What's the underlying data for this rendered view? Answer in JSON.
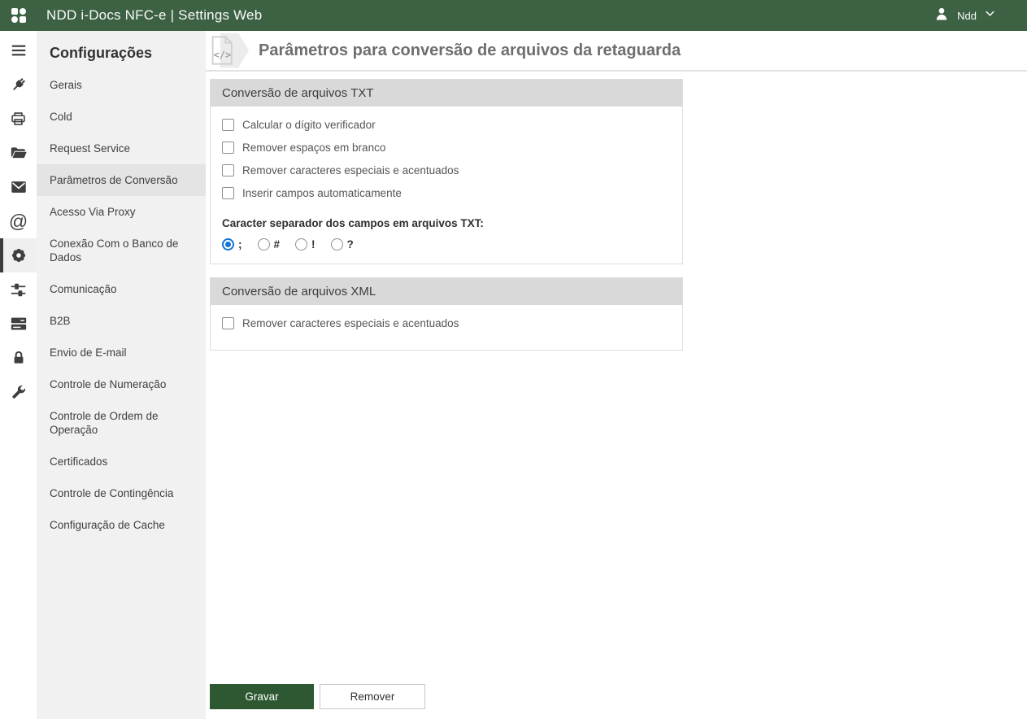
{
  "topbar": {
    "brand": "NDD i-Docs NFC-e | Settings Web",
    "user": {
      "name": "Ndd"
    }
  },
  "iconrail": {
    "items": [
      {
        "icon": "menu-icon"
      },
      {
        "icon": "plug-icon"
      },
      {
        "icon": "printer-icon"
      },
      {
        "icon": "folder-open-icon"
      },
      {
        "icon": "envelope-icon"
      },
      {
        "icon": "at-sign-icon"
      },
      {
        "icon": "gear-icon",
        "active": true
      },
      {
        "icon": "sliders-icon"
      },
      {
        "icon": "server-icon"
      },
      {
        "icon": "lock-icon"
      },
      {
        "icon": "wrench-icon"
      }
    ]
  },
  "sidebar": {
    "title": "Configurações",
    "items": [
      {
        "label": "Gerais"
      },
      {
        "label": "Cold"
      },
      {
        "label": "Request Service"
      },
      {
        "label": "Parâmetros de Conversão",
        "active": true
      },
      {
        "label": "Acesso Via Proxy"
      },
      {
        "label": "Conexão Com o Banco de Dados"
      },
      {
        "label": "Comunicação"
      },
      {
        "label": "B2B"
      },
      {
        "label": "Envio de E-mail"
      },
      {
        "label": "Controle de Numeração"
      },
      {
        "label": "Controle de Ordem de Operação"
      },
      {
        "label": "Certificados"
      },
      {
        "label": "Controle de Contingência"
      },
      {
        "label": "Configuração de Cache"
      }
    ]
  },
  "main": {
    "title": "Parâmetros para conversão de arquivos da retaguarda",
    "panels": [
      {
        "title": "Conversão de arquivos TXT",
        "checkboxes": [
          {
            "label": "Calcular o dígito verificador",
            "checked": false
          },
          {
            "label": "Remover espaços em branco",
            "checked": false
          },
          {
            "label": "Remover caracteres especiais e acentuados",
            "checked": false
          },
          {
            "label": "Inserir campos automaticamente",
            "checked": false
          }
        ],
        "separator_label": "Caracter separador dos campos em arquivos TXT:",
        "radios": [
          {
            "label": ";",
            "checked": true
          },
          {
            "label": "#",
            "checked": false
          },
          {
            "label": "!",
            "checked": false
          },
          {
            "label": "?",
            "checked": false
          }
        ]
      },
      {
        "title": "Conversão de arquivos XML",
        "checkboxes": [
          {
            "label": "Remover caracteres especiais e acentuados",
            "checked": false
          }
        ]
      }
    ],
    "buttons": {
      "save": "Gravar",
      "remove": "Remover"
    }
  },
  "colors": {
    "topbar_green": "#3c6143",
    "save_button_green": "#2d5831",
    "radio_selected_blue": "#1374d5",
    "sidebar_gray": "#f1f1f1",
    "panel_header_gray": "#d9d9d9"
  }
}
